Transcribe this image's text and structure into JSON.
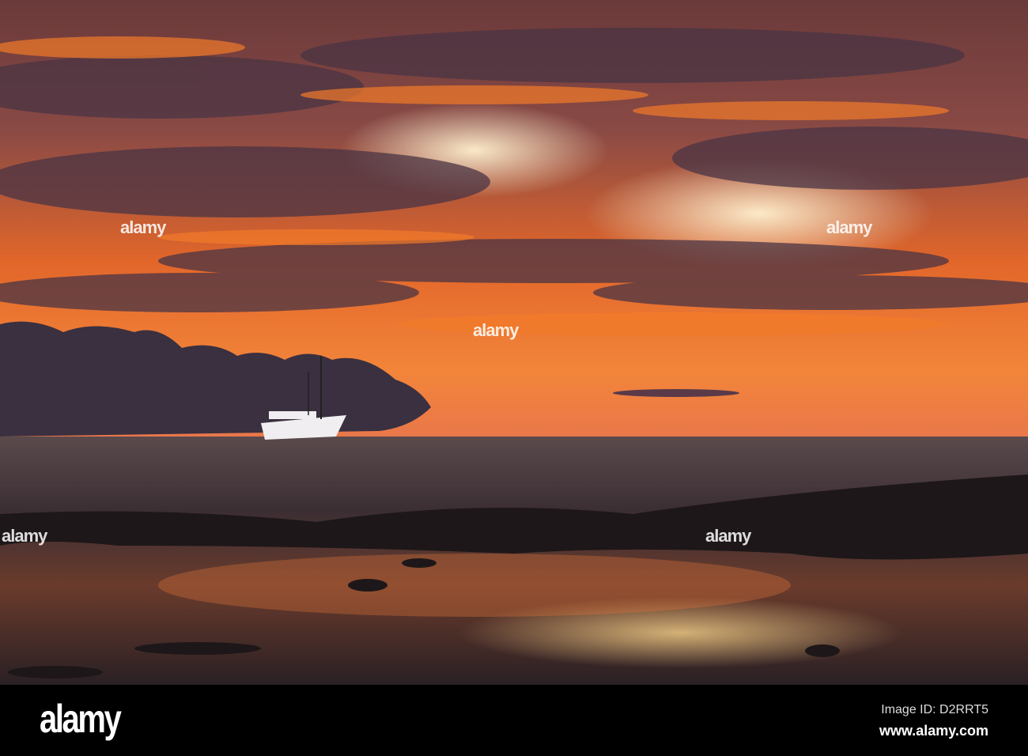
{
  "footer": {
    "logo": "alamy",
    "image_id": "Image ID: D2RRT5",
    "site": "www.alamy.com"
  },
  "watermark": "alamy",
  "colors": {
    "sky_orange": "#f06a1a",
    "cloud_dark": "#3a2f3e",
    "sea": "#2a2126",
    "glow": "#f9d9a0"
  }
}
